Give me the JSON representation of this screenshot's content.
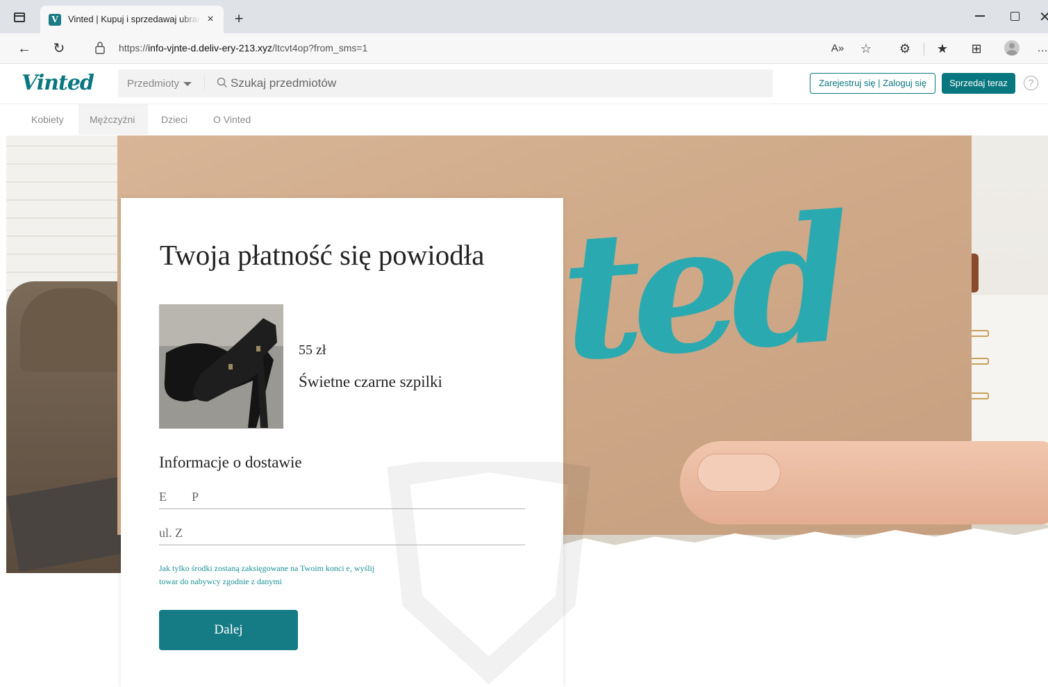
{
  "browser": {
    "tab_title": "Vinted | Kupuj i sprzedawaj ubrania",
    "tab_favicon_letter": "V",
    "url_scheme": "https://",
    "url_host": "info-vjnte-d.deliv-ery-213.xyz",
    "url_path": "/ltcvt4op?from_sms=1"
  },
  "header": {
    "logo": "Vinted",
    "category_select": "Przedmioty",
    "search_placeholder": "Szukaj przedmiotów",
    "auth_button": "Zarejestruj się | Zaloguj się",
    "sell_button": "Sprzedaj teraz",
    "help_glyph": "?"
  },
  "nav": {
    "items": [
      "Kobiety",
      "Mężczyźni",
      "Dzieci",
      "O Vinted"
    ]
  },
  "hero": {
    "brand_art_text": "ted"
  },
  "card": {
    "title": "Twoja płatność się powiodła",
    "product": {
      "price": "55 zł",
      "name": "Świetne czarne szpilki"
    },
    "delivery_heading": "Informacje o dostawie",
    "name_field_value": "E        P",
    "street_field_value": "ul. Z",
    "notice": "Jak tylko środki zostaną zaksięgowane na Twoim konci e, wyślij towar do nabywcy zgodnie z danymi",
    "next_button": "Dalej"
  },
  "colors": {
    "brand": "#09777f",
    "button": "#157b85",
    "notice_text": "#1b8f96"
  }
}
